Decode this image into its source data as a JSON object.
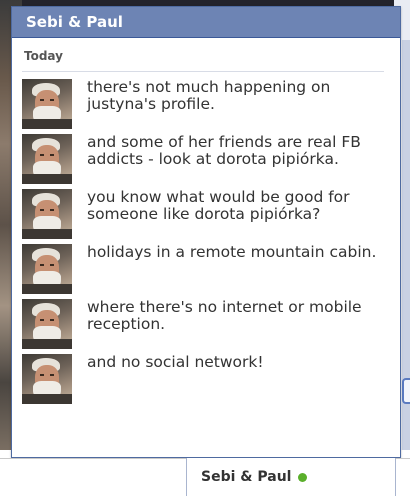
{
  "window": {
    "title": "Sebi & Paul"
  },
  "conversation": {
    "day_label": "Today",
    "messages": [
      {
        "text": "there's not much happening on justyna's profile."
      },
      {
        "text": "and some of her friends are real FB addicts - look at dorota pipiórka."
      },
      {
        "text": "you know what would be good for someone like dorota pipiórka?"
      },
      {
        "text": "holidays in a remote mountain cabin."
      },
      {
        "text": "where there's no internet or mobile reception."
      },
      {
        "text": "and no social network!"
      }
    ]
  },
  "chat_tab": {
    "name": "Sebi & Paul",
    "status": "online",
    "status_color": "#5aaf2b"
  },
  "colors": {
    "titlebar": "#6d84b4",
    "border": "#3b5998"
  }
}
